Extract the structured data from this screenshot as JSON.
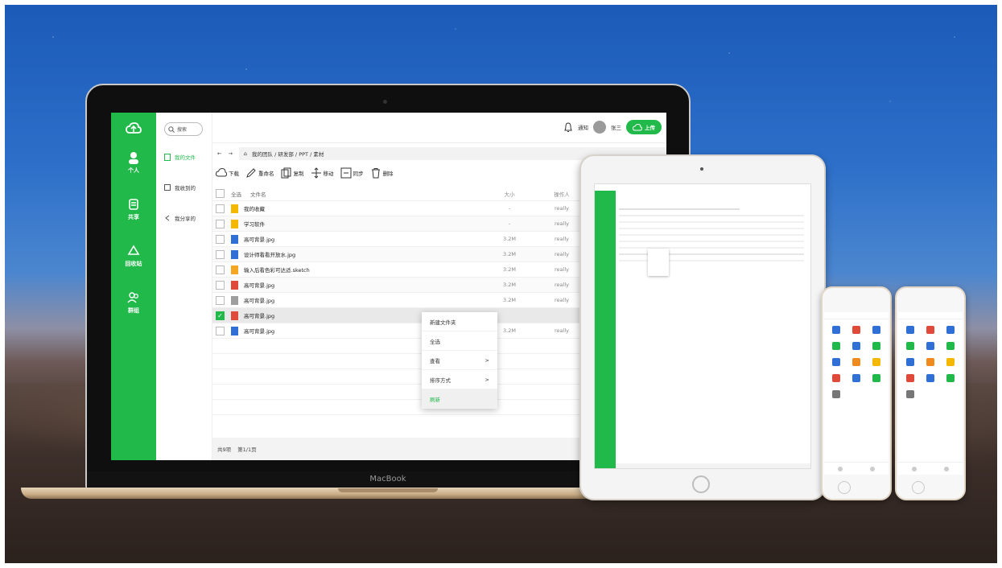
{
  "laptop": {
    "brand_label": "MacBook",
    "rail": [
      {
        "label": "个人"
      },
      {
        "label": "共享"
      },
      {
        "label": "回收站"
      },
      {
        "label": "群组"
      }
    ],
    "search": {
      "label": "搜索"
    },
    "side_nav": [
      {
        "label": "我的文件"
      },
      {
        "label": "我收到的"
      },
      {
        "label": "我分享的"
      }
    ],
    "topbar": {
      "notify_label": "通知",
      "user_name": "张三",
      "upload_label": "上传"
    },
    "path": {
      "back": "←",
      "forward": "→",
      "home": "⌂",
      "text": "我的团队 / 研发部 / PPT / 素材"
    },
    "toolbar": [
      "下载",
      "重命名",
      "复制",
      "移动",
      "同步",
      "删除"
    ],
    "table": {
      "headers": {
        "select_all": "全选",
        "name": "文件名",
        "size": "大小",
        "owner": "操作人"
      },
      "rows": [
        {
          "name": "我的收藏",
          "size": "-",
          "owner": "really",
          "icon": "folder-icon",
          "checked": false
        },
        {
          "name": "学习软件",
          "size": "-",
          "owner": "really",
          "icon": "folder-icon",
          "checked": false
        },
        {
          "name": "高可背景.jpg",
          "size": "3.2M",
          "owner": "really",
          "icon": "image-icon",
          "checked": false
        },
        {
          "name": "设计师看看开放水.jpg",
          "size": "3.2M",
          "owner": "really",
          "icon": "image-icon",
          "checked": false
        },
        {
          "name": "输入后看色彩可达适.sketch",
          "size": "3.2M",
          "owner": "really",
          "icon": "sketch-icon",
          "checked": false
        },
        {
          "name": "高可背景.jpg",
          "size": "3.2M",
          "owner": "really",
          "icon": "ppt-icon",
          "checked": false
        },
        {
          "name": "高可背景.jpg",
          "size": "3.2M",
          "owner": "really",
          "icon": "doc-icon",
          "checked": false
        },
        {
          "name": "高可背景.jpg",
          "size": "",
          "owner": "",
          "icon": "pdf-icon",
          "checked": true
        },
        {
          "name": "高可背景.jpg",
          "size": "3.2M",
          "owner": "really",
          "icon": "word-icon",
          "checked": false
        }
      ]
    },
    "context_menu": [
      {
        "label": "新建文件夹",
        "arrow": ""
      },
      {
        "label": "全选",
        "arrow": ""
      },
      {
        "label": "查看",
        "arrow": ">"
      },
      {
        "label": "排序方式",
        "arrow": ">"
      },
      {
        "label": "刷新",
        "arrow": ""
      }
    ],
    "footer": {
      "count": "共9项",
      "page": "第1/1页"
    }
  },
  "colors": {
    "brand_green": "#22b94b",
    "folder_yellow": "#f5b800"
  }
}
